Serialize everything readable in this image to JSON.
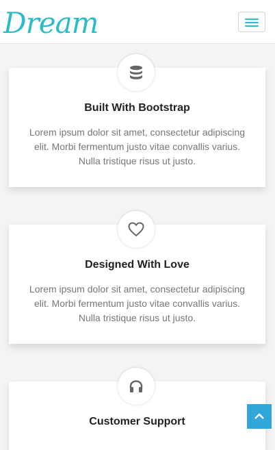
{
  "navbar": {
    "brand": "Dream",
    "menu_icon": "hamburger-menu-icon"
  },
  "features": [
    {
      "icon": "database-icon",
      "title": "Built With Bootstrap",
      "text": "Lorem ipsum dolor sit amet, consectetur adipiscing elit. Morbi fermentum justo vitae convallis varius. Nulla tristique risus ut justo."
    },
    {
      "icon": "heart-icon",
      "title": "Designed With Love",
      "text": "Lorem ipsum dolor sit amet, consectetur adipiscing elit. Morbi fermentum justo vitae convallis varius. Nulla tristique risus ut justo."
    },
    {
      "icon": "headphones-icon",
      "title": "Customer Support",
      "text": ""
    }
  ],
  "back_to_top_icon": "chevron-up-icon",
  "colors": {
    "accent": "#2bbcc6",
    "button": "#31a6d8"
  }
}
